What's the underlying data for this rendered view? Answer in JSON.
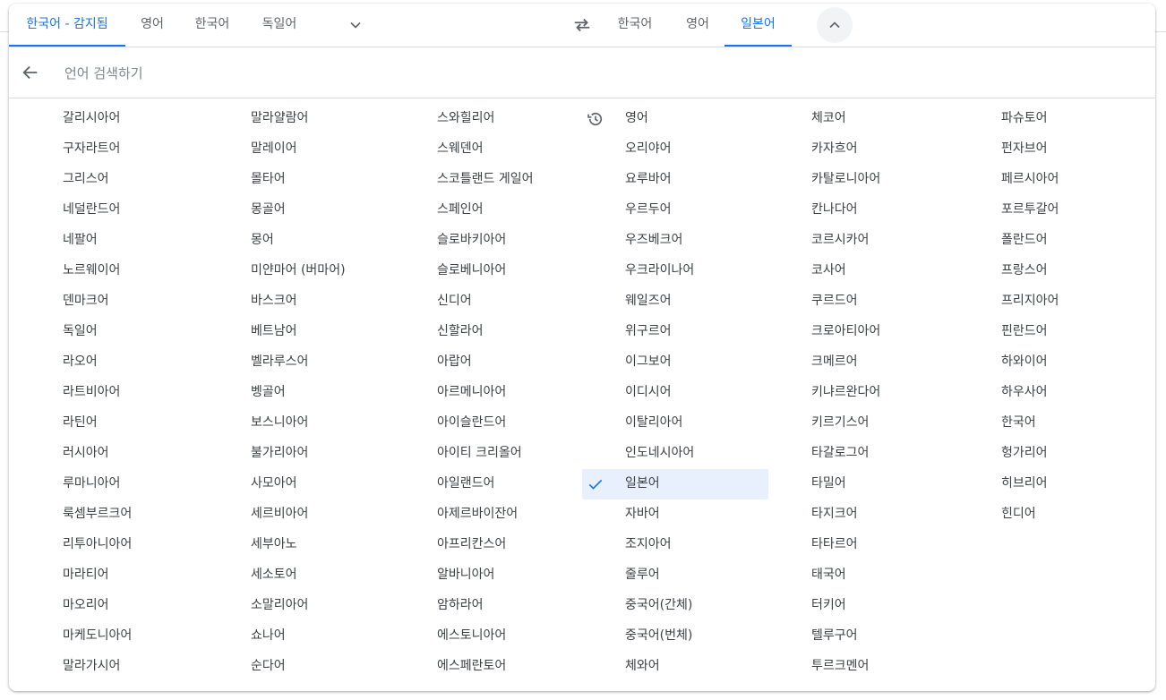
{
  "source_tabs": [
    "한국어 - 감지됨",
    "영어",
    "한국어",
    "독일어"
  ],
  "target_tabs": [
    "한국어",
    "영어",
    "일본어"
  ],
  "search": {
    "placeholder": "언어 검색하기",
    "value": ""
  },
  "icons": {
    "more_source": "chevron-down-icon",
    "swap": "swap-icon",
    "collapse": "chevron-up-icon",
    "back": "arrow-back-icon",
    "recent": "history-icon",
    "selected": "check-icon"
  },
  "colors": {
    "accent": "#1a73e8",
    "selected_bg": "#e8f0fe",
    "text": "#3c4043",
    "muted": "#5f6368"
  },
  "recent_language": "영어",
  "selected_language": "일본어",
  "languages": [
    [
      "갈리시아어",
      "구자라트어",
      "그리스어",
      "네덜란드어",
      "네팔어",
      "노르웨이어",
      "덴마크어",
      "독일어",
      "라오어",
      "라트비아어",
      "라틴어",
      "러시아어",
      "루마니아어",
      "룩셈부르크어",
      "리투아니아어",
      "마라티어",
      "마오리어",
      "마케도니아어",
      "말라가시어"
    ],
    [
      "말라얄람어",
      "말레이어",
      "몰타어",
      "몽골어",
      "몽어",
      "미얀마어 (버마어)",
      "바스크어",
      "베트남어",
      "벨라루스어",
      "벵골어",
      "보스니아어",
      "불가리아어",
      "사모아어",
      "세르비아어",
      "세부아노",
      "세소토어",
      "소말리아어",
      "쇼나어",
      "순다어"
    ],
    [
      "스와힐리어",
      "스웨덴어",
      "스코틀랜드 게일어",
      "스페인어",
      "슬로바키아어",
      "슬로베니아어",
      "신디어",
      "신할라어",
      "아랍어",
      "아르메니아어",
      "아이슬란드어",
      "아이티 크리올어",
      "아일랜드어",
      "아제르바이잔어",
      "아프리칸스어",
      "알바니아어",
      "암하라어",
      "에스토니아어",
      "에스페란토어"
    ],
    [
      "영어",
      "오리야어",
      "요루바어",
      "우르두어",
      "우즈베크어",
      "우크라이나어",
      "웨일즈어",
      "위구르어",
      "이그보어",
      "이디시어",
      "이탈리아어",
      "인도네시아어",
      "일본어",
      "자바어",
      "조지아어",
      "줄루어",
      "중국어(간체)",
      "중국어(번체)",
      "체와어"
    ],
    [
      "체코어",
      "카자흐어",
      "카탈로니아어",
      "칸나다어",
      "코르시카어",
      "코사어",
      "쿠르드어",
      "크로아티아어",
      "크메르어",
      "키냐르완다어",
      "키르기스어",
      "타갈로그어",
      "타밀어",
      "타지크어",
      "타타르어",
      "태국어",
      "터키어",
      "텔루구어",
      "투르크멘어"
    ],
    [
      "파슈토어",
      "펀자브어",
      "페르시아어",
      "포르투갈어",
      "폴란드어",
      "프랑스어",
      "프리지아어",
      "핀란드어",
      "하와이어",
      "하우사어",
      "한국어",
      "헝가리어",
      "히브리어",
      "힌디어"
    ]
  ]
}
